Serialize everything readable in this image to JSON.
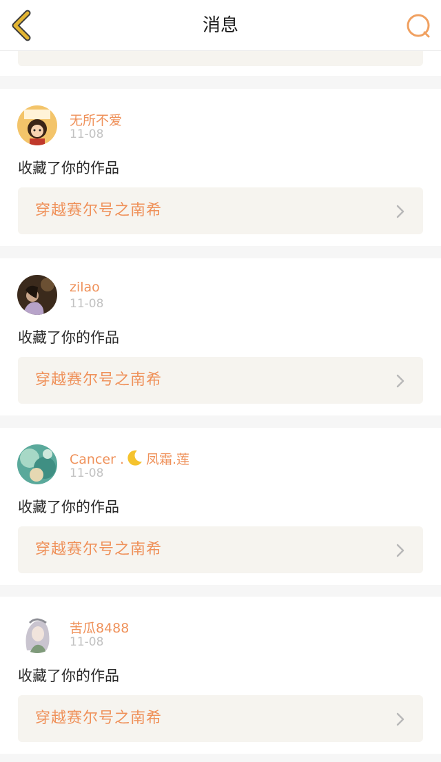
{
  "header": {
    "title": "消息"
  },
  "colors": {
    "accent": "#ef915a",
    "back_icon": "#e3b533",
    "search_icon": "#f0a060",
    "work_bg": "#f6f4ef"
  },
  "notifications": [
    {
      "user": "无所不爱",
      "date": "11-08",
      "action": "收藏了你的作品",
      "work_title": "穿越赛尔号之南希",
      "avatar": "cartoon-girl-avatar"
    },
    {
      "user": "zilao",
      "date": "11-08",
      "action": "收藏了你的作品",
      "work_title": "穿越赛尔号之南希",
      "avatar": "photo-avatar"
    },
    {
      "user": "Cancer .",
      "user_suffix": "凤霜.莲",
      "date": "11-08",
      "action": "收藏了你的作品",
      "work_title": "穿越赛尔号之南希",
      "avatar": "teal-pattern-avatar"
    },
    {
      "user": "苦瓜8488",
      "date": "11-08",
      "action": "收藏了你的作品",
      "work_title": "穿越赛尔号之南希",
      "avatar": "anime-girl-avatar"
    }
  ]
}
